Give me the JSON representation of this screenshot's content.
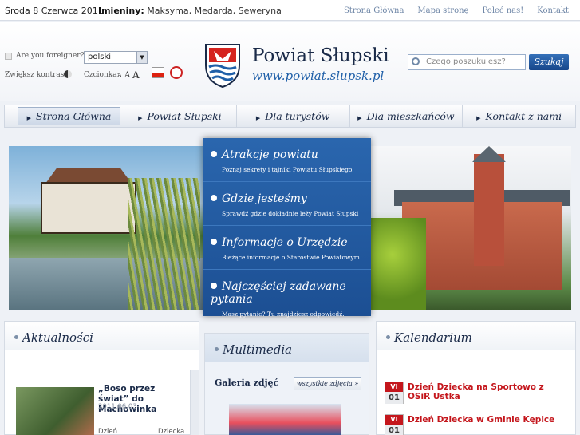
{
  "topbar": {
    "date": "Środa 8 Czerwca 2011",
    "namedays_label": "Imieniny:",
    "namedays": "Maksyma, Medarda, Seweryna",
    "links": [
      "Strona Główna",
      "Mapa stronę",
      "Poleć nas!",
      "Kontakt"
    ]
  },
  "tools": {
    "foreigner_label": "Are you foreigner?",
    "language": "polski",
    "contrast_label": "Zwiększ kontrast",
    "font_label": "Czcionka:",
    "font_sizes": [
      "A",
      "A",
      "A"
    ]
  },
  "brand": {
    "name": "Powiat Słupski",
    "url": "www.powiat.slupsk.pl"
  },
  "search": {
    "placeholder": "Czego poszukujesz?",
    "button": "Szukaj"
  },
  "nav": [
    "Strona Główna",
    "Powiat Słupski",
    "Dla turystów",
    "Dla mieszkańców",
    "Kontakt z nami"
  ],
  "hero_menu": [
    {
      "title": "Atrakcje powiatu",
      "desc": "Poznaj sekrety i tajniki Powiatu Słupskiego."
    },
    {
      "title": "Gdzie jesteśmy",
      "desc": "Sprawdź gdzie dokładnie leży Powiat Słupski"
    },
    {
      "title": "Informacje o Urzędzie",
      "desc": "Bieżące informacje o Starostwie Powiatowym."
    },
    {
      "title": "Najczęściej zadawane pytania",
      "desc": "Masz pytanie? Tu znajdziesz odpowiedź."
    }
  ],
  "news": {
    "heading": "Aktualności",
    "item_title": "„Boso przez świat” do Machowinka",
    "item_date": "2011.06.03",
    "item_more_1": "Dzień",
    "item_more_2": "Dziecka"
  },
  "multimedia": {
    "heading": "Multimedia",
    "gallery": "Galeria zdjęć",
    "all_button": "wszystkie zdjęcia »"
  },
  "calendar": {
    "heading": "Kalendarium",
    "events": [
      {
        "day": "VI",
        "num": "01",
        "title": "Dzień Dziecka na Sportowo z OSiR Ustka"
      },
      {
        "day": "VI",
        "num": "01",
        "title": "Dzień Dziecka w Gminie Kępice"
      }
    ]
  },
  "colors": {
    "primary": "#1c4f93",
    "accent": "#c4161c"
  }
}
